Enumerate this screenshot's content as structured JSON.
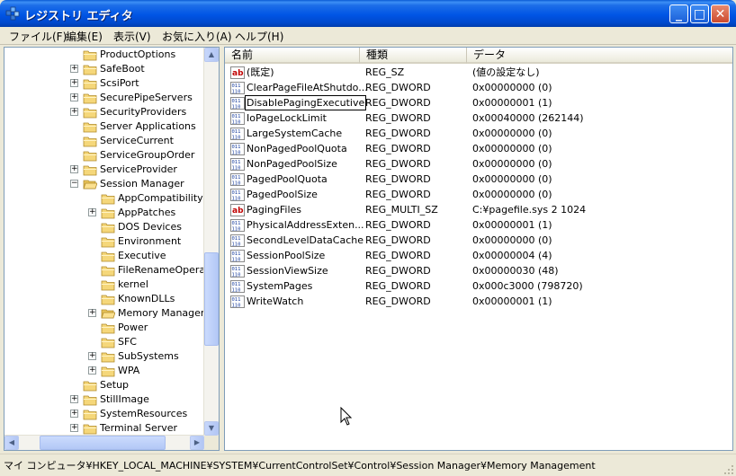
{
  "window": {
    "title": "レジストリ エディタ"
  },
  "title_buttons": {
    "minimize": "_",
    "maximize": "□",
    "close": "✕"
  },
  "menu": [
    "ファイル(F)",
    "編集(E)",
    "表示(V)",
    "お気に入り(A)",
    "ヘルプ(H)"
  ],
  "tree": [
    {
      "label": "ProductOptions",
      "level": 0,
      "expander": false
    },
    {
      "label": "SafeBoot",
      "level": 0,
      "expander": true
    },
    {
      "label": "ScsiPort",
      "level": 0,
      "expander": true
    },
    {
      "label": "SecurePipeServers",
      "level": 0,
      "expander": true
    },
    {
      "label": "SecurityProviders",
      "level": 0,
      "expander": true
    },
    {
      "label": "Server Applications",
      "level": 0,
      "expander": false
    },
    {
      "label": "ServiceCurrent",
      "level": 0,
      "expander": false
    },
    {
      "label": "ServiceGroupOrder",
      "level": 0,
      "expander": false
    },
    {
      "label": "ServiceProvider",
      "level": 0,
      "expander": true
    },
    {
      "label": "Session Manager",
      "level": 0,
      "expander": true,
      "expanded": true,
      "open": true
    },
    {
      "label": "AppCompatibility",
      "level": 1,
      "expander": false
    },
    {
      "label": "AppPatches",
      "level": 1,
      "expander": true
    },
    {
      "label": "DOS Devices",
      "level": 1,
      "expander": false
    },
    {
      "label": "Environment",
      "level": 1,
      "expander": false
    },
    {
      "label": "Executive",
      "level": 1,
      "expander": false
    },
    {
      "label": "FileRenameOperat",
      "level": 1,
      "expander": false
    },
    {
      "label": "kernel",
      "level": 1,
      "expander": false
    },
    {
      "label": "KnownDLLs",
      "level": 1,
      "expander": false
    },
    {
      "label": "Memory Manageme",
      "level": 1,
      "expander": true,
      "open": true
    },
    {
      "label": "Power",
      "level": 1,
      "expander": false
    },
    {
      "label": "SFC",
      "level": 1,
      "expander": false
    },
    {
      "label": "SubSystems",
      "level": 1,
      "expander": true
    },
    {
      "label": "WPA",
      "level": 1,
      "expander": true
    },
    {
      "label": "Setup",
      "level": 0,
      "expander": false
    },
    {
      "label": "StillImage",
      "level": 0,
      "expander": true
    },
    {
      "label": "SystemResources",
      "level": 0,
      "expander": true
    },
    {
      "label": "Terminal Server",
      "level": 0,
      "expander": true
    }
  ],
  "list": {
    "headers": [
      "名前",
      "種類",
      "データ"
    ],
    "values": [
      {
        "name": "(既定)",
        "type": "REG_SZ",
        "data": "(値の設定なし)",
        "icon": "string"
      },
      {
        "name": "ClearPageFileAtShutdo...",
        "type": "REG_DWORD",
        "data": "0x00000000 (0)",
        "icon": "binary"
      },
      {
        "name": "DisablePagingExecutive",
        "type": "REG_DWORD",
        "data": "0x00000001 (1)",
        "icon": "binary",
        "selected": true
      },
      {
        "name": "IoPageLockLimit",
        "type": "REG_DWORD",
        "data": "0x00040000 (262144)",
        "icon": "binary"
      },
      {
        "name": "LargeSystemCache",
        "type": "REG_DWORD",
        "data": "0x00000000 (0)",
        "icon": "binary"
      },
      {
        "name": "NonPagedPoolQuota",
        "type": "REG_DWORD",
        "data": "0x00000000 (0)",
        "icon": "binary"
      },
      {
        "name": "NonPagedPoolSize",
        "type": "REG_DWORD",
        "data": "0x00000000 (0)",
        "icon": "binary"
      },
      {
        "name": "PagedPoolQuota",
        "type": "REG_DWORD",
        "data": "0x00000000 (0)",
        "icon": "binary"
      },
      {
        "name": "PagedPoolSize",
        "type": "REG_DWORD",
        "data": "0x00000000 (0)",
        "icon": "binary"
      },
      {
        "name": "PagingFiles",
        "type": "REG_MULTI_SZ",
        "data": "C:¥pagefile.sys 2 1024",
        "icon": "string"
      },
      {
        "name": "PhysicalAddressExten...",
        "type": "REG_DWORD",
        "data": "0x00000001 (1)",
        "icon": "binary"
      },
      {
        "name": "SecondLevelDataCache",
        "type": "REG_DWORD",
        "data": "0x00000000 (0)",
        "icon": "binary"
      },
      {
        "name": "SessionPoolSize",
        "type": "REG_DWORD",
        "data": "0x00000004 (4)",
        "icon": "binary"
      },
      {
        "name": "SessionViewSize",
        "type": "REG_DWORD",
        "data": "0x00000030 (48)",
        "icon": "binary"
      },
      {
        "name": "SystemPages",
        "type": "REG_DWORD",
        "data": "0x000c3000 (798720)",
        "icon": "binary"
      },
      {
        "name": "WriteWatch",
        "type": "REG_DWORD",
        "data": "0x00000001 (1)",
        "icon": "binary"
      }
    ]
  },
  "status": "マイ コンピュータ¥HKEY_LOCAL_MACHINE¥SYSTEM¥CurrentControlSet¥Control¥Session Manager¥Memory Management",
  "colors": {
    "titlebar": "#0055e5",
    "face": "#ece9d8",
    "folder": "#f5d77a"
  }
}
